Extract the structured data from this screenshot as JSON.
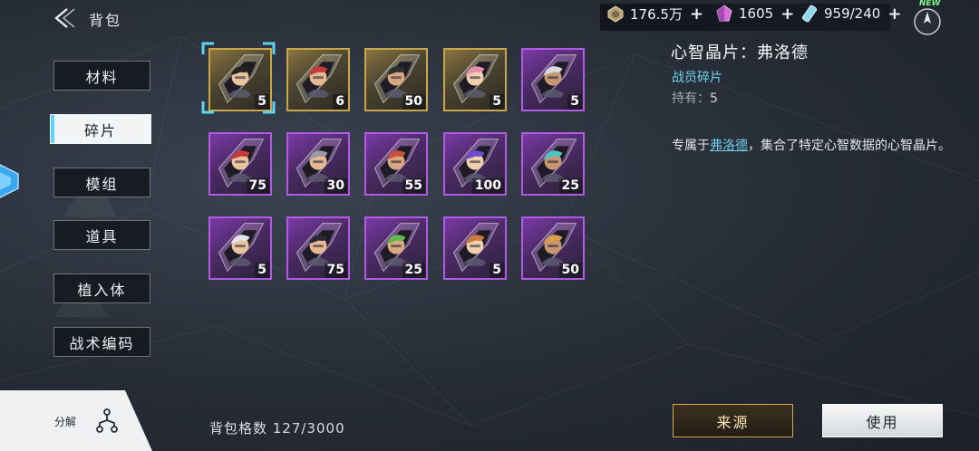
{
  "header": {
    "title": "背包"
  },
  "resources": [
    {
      "name": "credits",
      "icon": "credit-icon",
      "value": "176.5万"
    },
    {
      "name": "crystals",
      "icon": "crystal-icon",
      "value": "1605"
    },
    {
      "name": "stamina",
      "icon": "stamina-icon",
      "value": "959/240"
    }
  ],
  "compass_badge": "NEW",
  "nav": [
    {
      "id": "materials",
      "label": "材料",
      "active": false
    },
    {
      "id": "fragments",
      "label": "碎片",
      "active": true
    },
    {
      "id": "modules",
      "label": "模组",
      "active": false
    },
    {
      "id": "props",
      "label": "道具",
      "active": false
    },
    {
      "id": "implants",
      "label": "植入体",
      "active": false
    },
    {
      "id": "tactical-codes",
      "label": "战术编码",
      "active": false
    }
  ],
  "decompose_label": "分解",
  "capacity": "背包格数 127/3000",
  "items": [
    {
      "rarity": "gold",
      "count": "5",
      "selected": true
    },
    {
      "rarity": "gold",
      "count": "6"
    },
    {
      "rarity": "gold",
      "count": "50"
    },
    {
      "rarity": "gold",
      "count": "5"
    },
    {
      "rarity": "purple",
      "count": "5"
    },
    {
      "rarity": "purple",
      "count": "75"
    },
    {
      "rarity": "purple",
      "count": "30"
    },
    {
      "rarity": "purple",
      "count": "55"
    },
    {
      "rarity": "purple",
      "count": "100"
    },
    {
      "rarity": "purple",
      "count": "25"
    },
    {
      "rarity": "purple",
      "count": "5"
    },
    {
      "rarity": "purple",
      "count": "75"
    },
    {
      "rarity": "purple",
      "count": "25"
    },
    {
      "rarity": "purple",
      "count": "5"
    },
    {
      "rarity": "purple",
      "count": "50"
    }
  ],
  "detail": {
    "name": "心智晶片：弗洛德",
    "type": "战员碎片",
    "own_label": "持有：",
    "own_value": "5",
    "desc_prefix": "专属于",
    "desc_link": "弗洛德",
    "desc_suffix": "，集合了特定心智数据的心智晶片。"
  },
  "buttons": {
    "source": "来源",
    "use": "使用"
  },
  "colors": {
    "accent": "#6fd0ec",
    "gold": "#c9a64a",
    "purple": "#b05ae6"
  }
}
